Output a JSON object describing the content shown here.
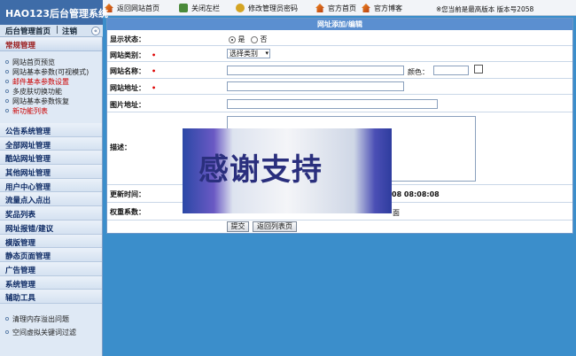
{
  "app": {
    "title": "HAO123后台管理系统"
  },
  "header": {
    "home_link": "后台管理首页",
    "separator": "|",
    "logout_link": "注销",
    "collapse_icon": "«",
    "nav": [
      {
        "icon": "home-icon",
        "label": "返回网站首页"
      },
      {
        "icon": "close-icon",
        "label": "关闭左栏"
      },
      {
        "icon": "key-icon",
        "label": "修改管理员密码"
      },
      {
        "icon": "home-icon",
        "label": "官方首页"
      },
      {
        "icon": "home-icon",
        "label": "官方博客"
      }
    ],
    "version_text": "※您当前是最高版本 版本号2058"
  },
  "sidebar": {
    "section_title": "常规管理",
    "sub_items": [
      {
        "label": "网站首页预览",
        "color": "black"
      },
      {
        "label": "网站基本参数(可视模式)",
        "color": "black"
      },
      {
        "label": "邮件基本参数设置",
        "color": "red"
      },
      {
        "label": "多皮肤切换功能",
        "color": "black"
      },
      {
        "label": "网站基本参数恢复",
        "color": "black"
      },
      {
        "label": "新功能列表",
        "color": "red"
      }
    ],
    "categories": [
      "公告系统管理",
      "全部网址管理",
      "酷站网址管理",
      "其他网址管理",
      "用户中心管理",
      "流量点入点出",
      "奖品列表",
      "网址报错/建议",
      "模版管理",
      "静态页面管理",
      "广告管理",
      "系统管理",
      "辅助工具"
    ],
    "tools": [
      "清理内存溢出问题",
      "空间虚拟关键词过滤"
    ]
  },
  "form": {
    "title": "网址添加/编辑",
    "display_label": "显示状态：",
    "display_yes": "是",
    "display_no": "否",
    "category_label": "网站类别：",
    "category_value": "选择类别",
    "name_label": "网站名称：",
    "color_label": "颜色：",
    "url_label": "网站地址：",
    "image_label": "图片地址：",
    "desc_label": "描述：",
    "update_label": "更新时间：",
    "update_value": "08 08:08:08",
    "weight_label": "权重系数：",
    "weight_tail": "面",
    "submit_label": "提交",
    "back_label": "返回列表页"
  },
  "overlay": {
    "text": "感谢支持"
  }
}
